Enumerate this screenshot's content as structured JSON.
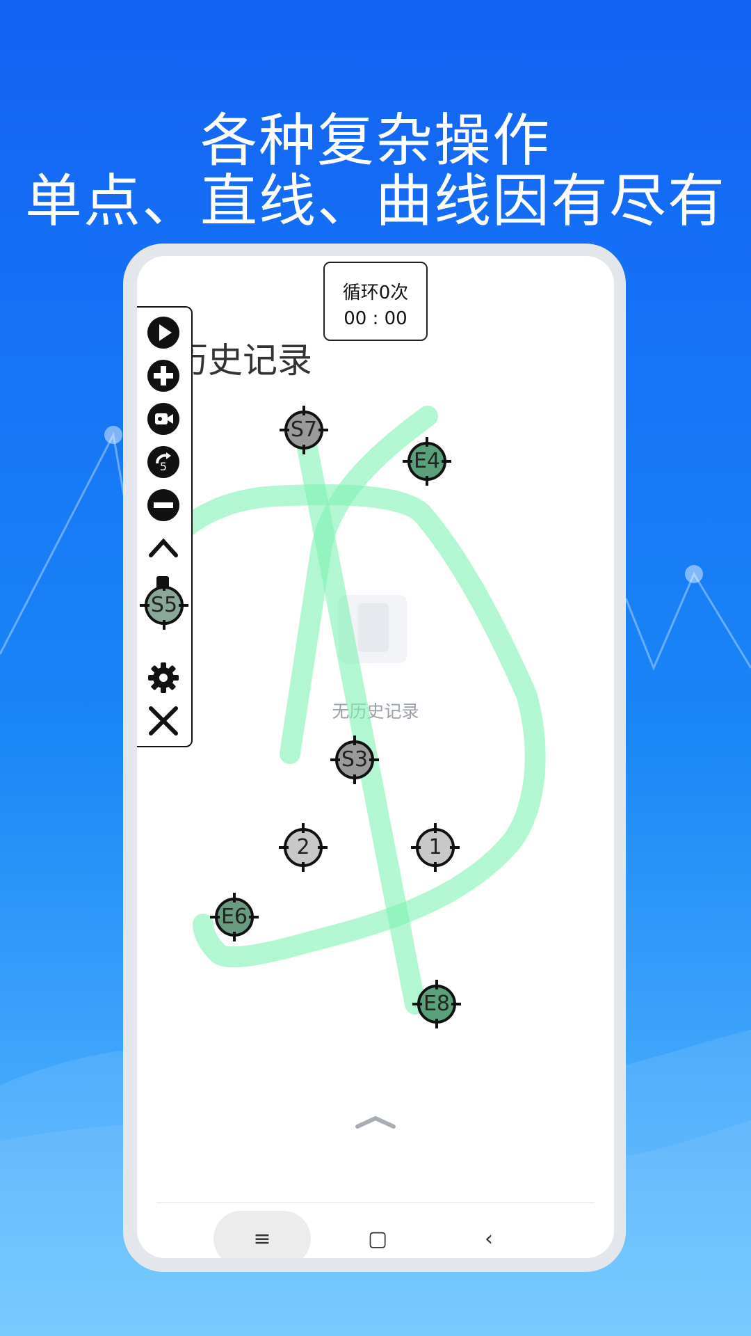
{
  "promo": {
    "line1": "各种复杂操作",
    "line2": "单点、直线、曲线因有尽有"
  },
  "screen": {
    "loop_counter": {
      "label": "循环0次",
      "time": "00 : 00"
    },
    "history_title": "历史记录",
    "empty_state": "无历史记录"
  },
  "toolbar": {
    "buttons": [
      "play-icon",
      "add-icon",
      "record-icon",
      "replay-icon",
      "remove-icon",
      "collapse-up-icon",
      "script-icon",
      "settings-icon",
      "close-icon"
    ]
  },
  "markers": {
    "s7": "S7",
    "e4": "E4",
    "s5": "S5",
    "s3": "S3",
    "p2": "2",
    "p1": "1",
    "e6": "E6",
    "e8": "E8"
  },
  "colors": {
    "stroke": "#7ef2b4",
    "marker_gray": "#9a9a9a",
    "marker_green": "#5aa07a",
    "marker_light": "#c8c8c8"
  },
  "nav": {
    "menu": "≡",
    "home": "▢",
    "back": "‹"
  }
}
